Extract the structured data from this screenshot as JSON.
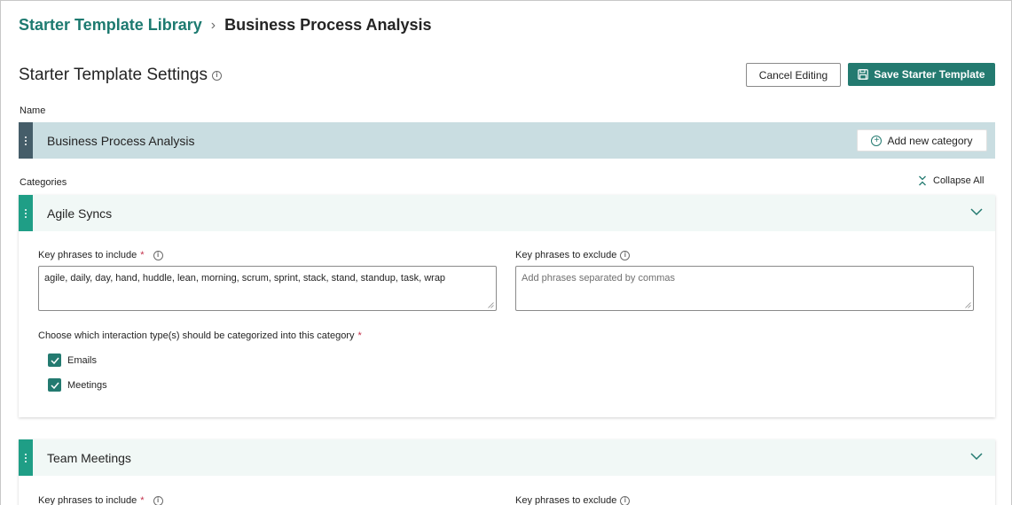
{
  "breadcrumb": {
    "library": "Starter Template Library",
    "current": "Business Process Analysis"
  },
  "header": {
    "title": "Starter Template Settings",
    "cancel_label": "Cancel Editing",
    "save_label": "Save Starter Template"
  },
  "name_section": {
    "label": "Name",
    "value": "Business Process Analysis",
    "add_category_label": "Add new category"
  },
  "categories_section": {
    "label": "Categories",
    "collapse_all_label": "Collapse All"
  },
  "categories": [
    {
      "title": "Agile Syncs",
      "include_label": "Key phrases to include",
      "include_value": "agile, daily, day, hand, huddle, lean, morning, scrum, sprint, stack, stand, standup, task, wrap",
      "exclude_label": "Key phrases to exclude",
      "exclude_placeholder": "Add phrases separated by commas",
      "interaction_label": "Choose which interaction type(s) should be categorized into this category",
      "interaction_types": [
        "Emails",
        "Meetings"
      ]
    },
    {
      "title": "Team Meetings",
      "include_label": "Key phrases to include",
      "exclude_label": "Key phrases to exclude"
    }
  ],
  "colors": {
    "accent": "#237a70",
    "name_bar": "#c9dde1",
    "category_handle": "#1f9e86"
  }
}
